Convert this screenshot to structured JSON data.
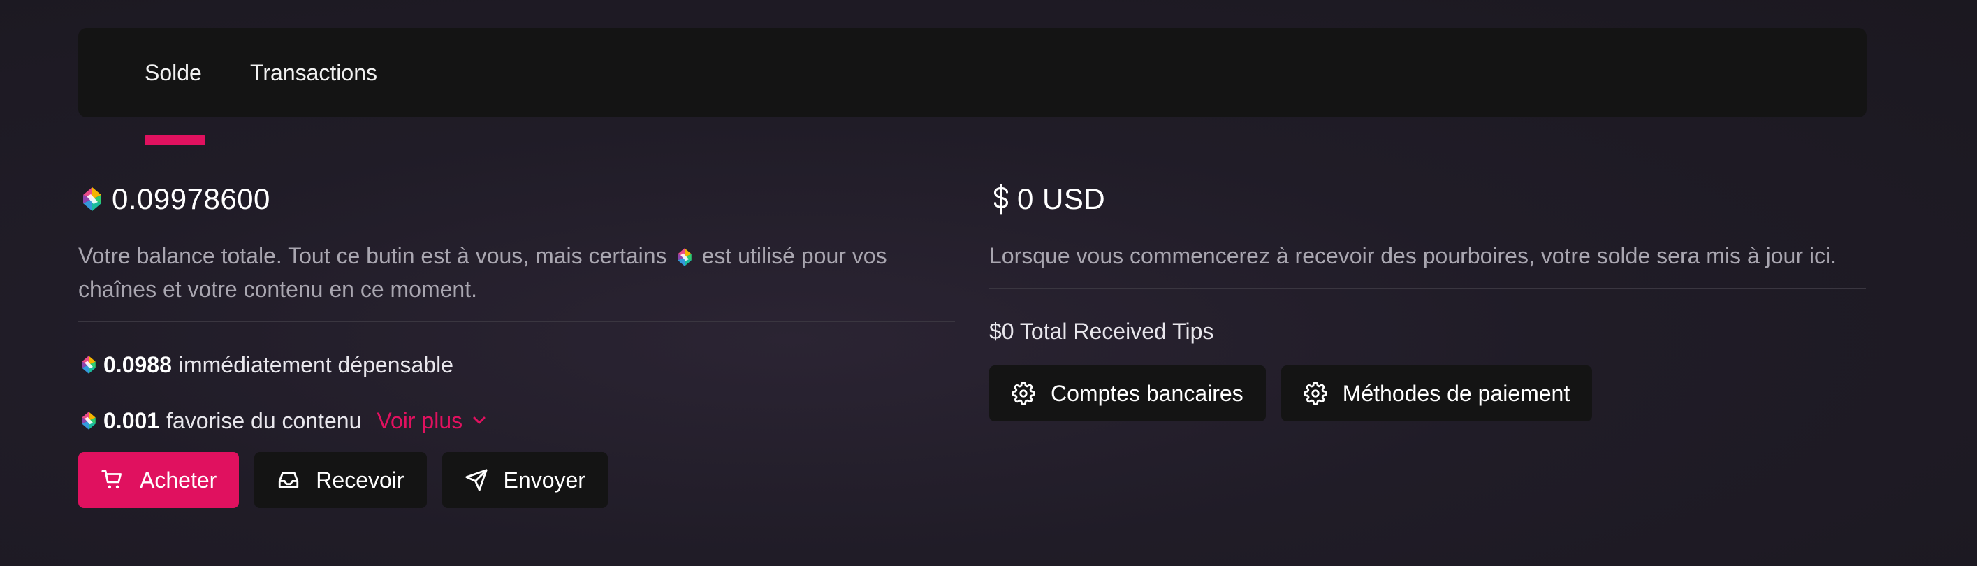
{
  "tabs": {
    "solde": "Solde",
    "transactions": "Transactions"
  },
  "left": {
    "balance": "0.09978600",
    "description_part1": "Votre balance totale. Tout ce butin est à vous, mais certains",
    "description_part2": "est utilisé pour vos chaînes et votre contenu en ce moment.",
    "spendable_value": "0.0988",
    "spendable_label": "immédiatement dépensable",
    "favored_value": "0.001",
    "favored_label": "favorise du contenu",
    "see_more": "Voir plus",
    "buttons": {
      "buy": "Acheter",
      "receive": "Recevoir",
      "send": "Envoyer"
    }
  },
  "right": {
    "amount": "0 USD",
    "description": "Lorsque vous commencerez à recevoir des pourboires, votre solde sera mis à jour ici.",
    "tips": "$0 Total Received Tips",
    "buttons": {
      "bank_accounts": "Comptes bancaires",
      "payment_methods": "Méthodes de paiement"
    }
  },
  "colors": {
    "accent": "#e0115f",
    "surface": "#141414",
    "muted_text": "#a9a6b0"
  },
  "icons": [
    "lbc-token-icon",
    "dollar-icon",
    "chevron-down-icon",
    "cart-icon",
    "inbox-icon",
    "send-icon",
    "gear-icon"
  ]
}
